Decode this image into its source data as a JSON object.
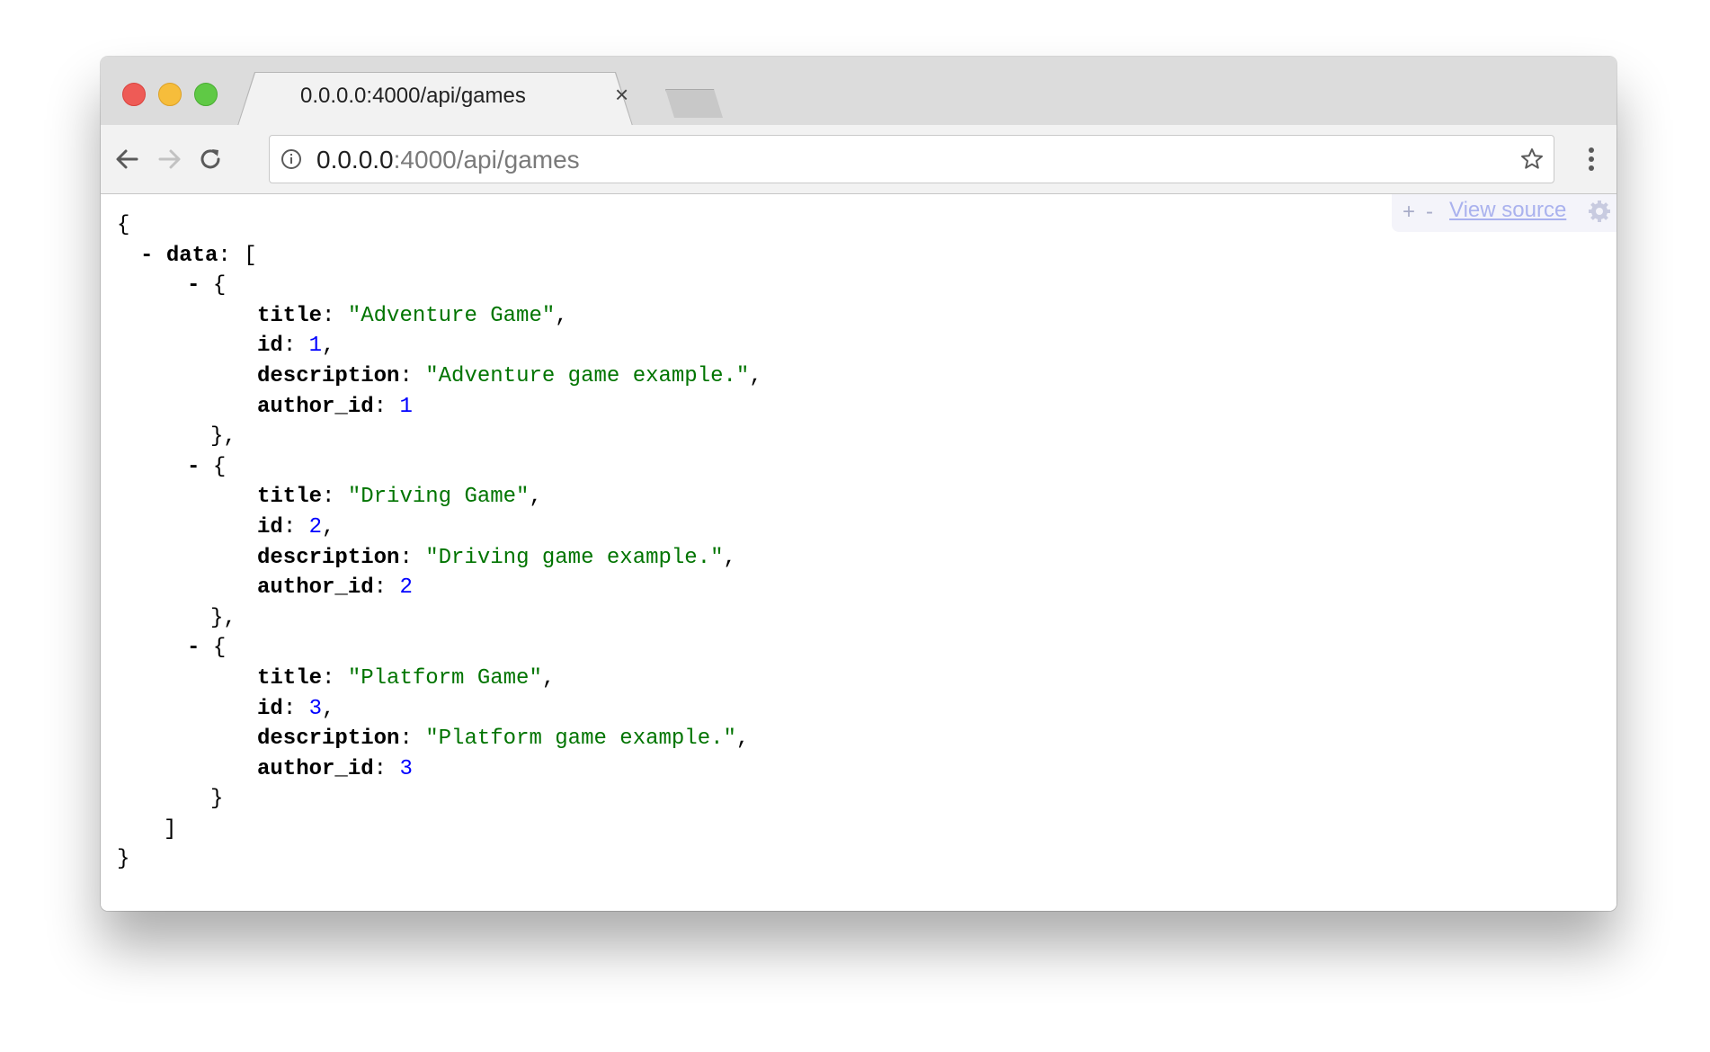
{
  "browser": {
    "tab_title": "0.0.0.0:4000/api/games",
    "url_host": "0.0.0.0",
    "url_rest": ":4000/api/games"
  },
  "viewer": {
    "expand_label": "+",
    "collapse_label": "-",
    "view_source_label": "View source"
  },
  "json_lines": [
    {
      "indent": 0,
      "parts": [
        {
          "t": "p",
          "v": "{"
        }
      ]
    },
    {
      "indent": 1,
      "parts": [
        {
          "t": "c",
          "v": "- "
        },
        {
          "t": "k",
          "v": "data"
        },
        {
          "t": "p",
          "v": ": ["
        }
      ]
    },
    {
      "indent": 3,
      "parts": [
        {
          "t": "c",
          "v": "- "
        },
        {
          "t": "p",
          "v": "{"
        }
      ]
    },
    {
      "indent": 6,
      "parts": [
        {
          "t": "k",
          "v": "title"
        },
        {
          "t": "p",
          "v": ": "
        },
        {
          "t": "s",
          "v": "\"Adventure Game\""
        },
        {
          "t": "p",
          "v": ","
        }
      ]
    },
    {
      "indent": 6,
      "parts": [
        {
          "t": "k",
          "v": "id"
        },
        {
          "t": "p",
          "v": ": "
        },
        {
          "t": "n",
          "v": "1"
        },
        {
          "t": "p",
          "v": ","
        }
      ]
    },
    {
      "indent": 6,
      "parts": [
        {
          "t": "k",
          "v": "description"
        },
        {
          "t": "p",
          "v": ": "
        },
        {
          "t": "s",
          "v": "\"Adventure game example.\""
        },
        {
          "t": "p",
          "v": ","
        }
      ]
    },
    {
      "indent": 6,
      "parts": [
        {
          "t": "k",
          "v": "author_id"
        },
        {
          "t": "p",
          "v": ": "
        },
        {
          "t": "n",
          "v": "1"
        }
      ]
    },
    {
      "indent": 4,
      "parts": [
        {
          "t": "p",
          "v": "},"
        }
      ]
    },
    {
      "indent": 3,
      "parts": [
        {
          "t": "c",
          "v": "- "
        },
        {
          "t": "p",
          "v": "{"
        }
      ]
    },
    {
      "indent": 6,
      "parts": [
        {
          "t": "k",
          "v": "title"
        },
        {
          "t": "p",
          "v": ": "
        },
        {
          "t": "s",
          "v": "\"Driving Game\""
        },
        {
          "t": "p",
          "v": ","
        }
      ]
    },
    {
      "indent": 6,
      "parts": [
        {
          "t": "k",
          "v": "id"
        },
        {
          "t": "p",
          "v": ": "
        },
        {
          "t": "n",
          "v": "2"
        },
        {
          "t": "p",
          "v": ","
        }
      ]
    },
    {
      "indent": 6,
      "parts": [
        {
          "t": "k",
          "v": "description"
        },
        {
          "t": "p",
          "v": ": "
        },
        {
          "t": "s",
          "v": "\"Driving game example.\""
        },
        {
          "t": "p",
          "v": ","
        }
      ]
    },
    {
      "indent": 6,
      "parts": [
        {
          "t": "k",
          "v": "author_id"
        },
        {
          "t": "p",
          "v": ": "
        },
        {
          "t": "n",
          "v": "2"
        }
      ]
    },
    {
      "indent": 4,
      "parts": [
        {
          "t": "p",
          "v": "},"
        }
      ]
    },
    {
      "indent": 3,
      "parts": [
        {
          "t": "c",
          "v": "- "
        },
        {
          "t": "p",
          "v": "{"
        }
      ]
    },
    {
      "indent": 6,
      "parts": [
        {
          "t": "k",
          "v": "title"
        },
        {
          "t": "p",
          "v": ": "
        },
        {
          "t": "s",
          "v": "\"Platform Game\""
        },
        {
          "t": "p",
          "v": ","
        }
      ]
    },
    {
      "indent": 6,
      "parts": [
        {
          "t": "k",
          "v": "id"
        },
        {
          "t": "p",
          "v": ": "
        },
        {
          "t": "n",
          "v": "3"
        },
        {
          "t": "p",
          "v": ","
        }
      ]
    },
    {
      "indent": 6,
      "parts": [
        {
          "t": "k",
          "v": "description"
        },
        {
          "t": "p",
          "v": ": "
        },
        {
          "t": "s",
          "v": "\"Platform game example.\""
        },
        {
          "t": "p",
          "v": ","
        }
      ]
    },
    {
      "indent": 6,
      "parts": [
        {
          "t": "k",
          "v": "author_id"
        },
        {
          "t": "p",
          "v": ": "
        },
        {
          "t": "n",
          "v": "3"
        }
      ]
    },
    {
      "indent": 4,
      "parts": [
        {
          "t": "p",
          "v": "}"
        }
      ]
    },
    {
      "indent": 2,
      "parts": [
        {
          "t": "p",
          "v": "]"
        }
      ]
    },
    {
      "indent": 0,
      "parts": [
        {
          "t": "p",
          "v": "}"
        }
      ]
    }
  ],
  "colors": {
    "string": "#007400",
    "number": "#0000ff",
    "view_source_link": "#aab2ee"
  }
}
